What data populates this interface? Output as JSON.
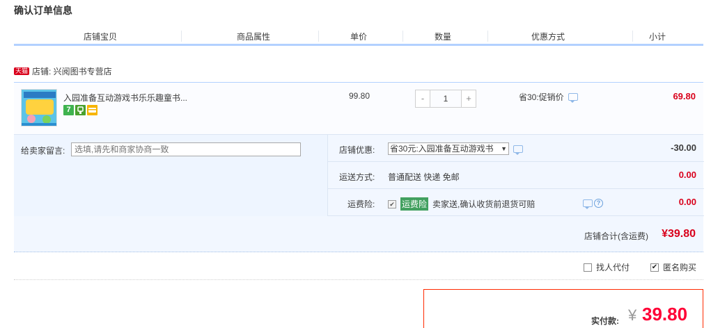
{
  "page_title": "确认订单信息",
  "columns": [
    "店铺宝贝",
    "商品属性",
    "单价",
    "数量",
    "优惠方式",
    "小计"
  ],
  "store": {
    "badge": "天猫",
    "label": "店铺: 兴阅图书专营店"
  },
  "item": {
    "title": "入园准备互动游戏书乐乐趣童书...",
    "service_icons": [
      "seven-day-return-icon",
      "guarantee-icon",
      "credit-card-icon"
    ],
    "service_seven": "7",
    "unit_price": "99.80",
    "qty_minus": "-",
    "quantity": "1",
    "qty_plus": "+",
    "promotion": "省30:促销价",
    "subtotal": "69.80"
  },
  "message": {
    "label": "给卖家留言:",
    "placeholder": "选填,请先和商家协商一致"
  },
  "store_discount": {
    "label": "店铺优惠:",
    "selected": "省30元:入园准备互动游戏书",
    "arrow": "▼",
    "amount": "-30.00"
  },
  "shipping": {
    "label": "运送方式:",
    "value": "普通配送 快递 免邮",
    "amount": "0.00"
  },
  "insurance": {
    "label": "运费险:",
    "checked": true,
    "check_mark": "✔",
    "badge": "运费险",
    "text": "卖家送,确认收货前退货可赔",
    "help": "?",
    "amount": "0.00"
  },
  "store_total": {
    "label": "店铺合计(含运费)",
    "value": "¥39.80"
  },
  "options": {
    "proxy_pay": "找人代付",
    "proxy_checked": false,
    "anonymous": "匿名购买",
    "anonymous_checked": true,
    "check_mark": "✔"
  },
  "payment": {
    "label": "实付款:",
    "currency": "¥",
    "amount": "39.80"
  },
  "colors": {
    "accent_red": "#d9001b",
    "pay_red": "#ff0036",
    "blue_border": "#b2d1ff",
    "light_bg": "#f2f7ff",
    "insurance_green": "#42a05f"
  }
}
